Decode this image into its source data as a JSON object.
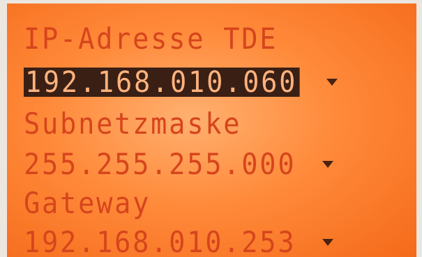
{
  "screen": {
    "colors": {
      "backlight": "#ff8a3a",
      "text": "#d6451c",
      "selection_bg": "#3a1f14",
      "selection_text": "#ffb27e"
    },
    "fields": [
      {
        "label": "IP-Adresse TDE",
        "value": "192.168.010.060",
        "selected": true,
        "dropdown_icon": "triangle-down"
      },
      {
        "label": "Subnetzmaske",
        "value": "255.255.255.000",
        "selected": false,
        "dropdown_icon": "triangle-down"
      },
      {
        "label": "Gateway",
        "value": "192.168.010.253",
        "selected": false,
        "dropdown_icon": "triangle-down"
      }
    ]
  }
}
